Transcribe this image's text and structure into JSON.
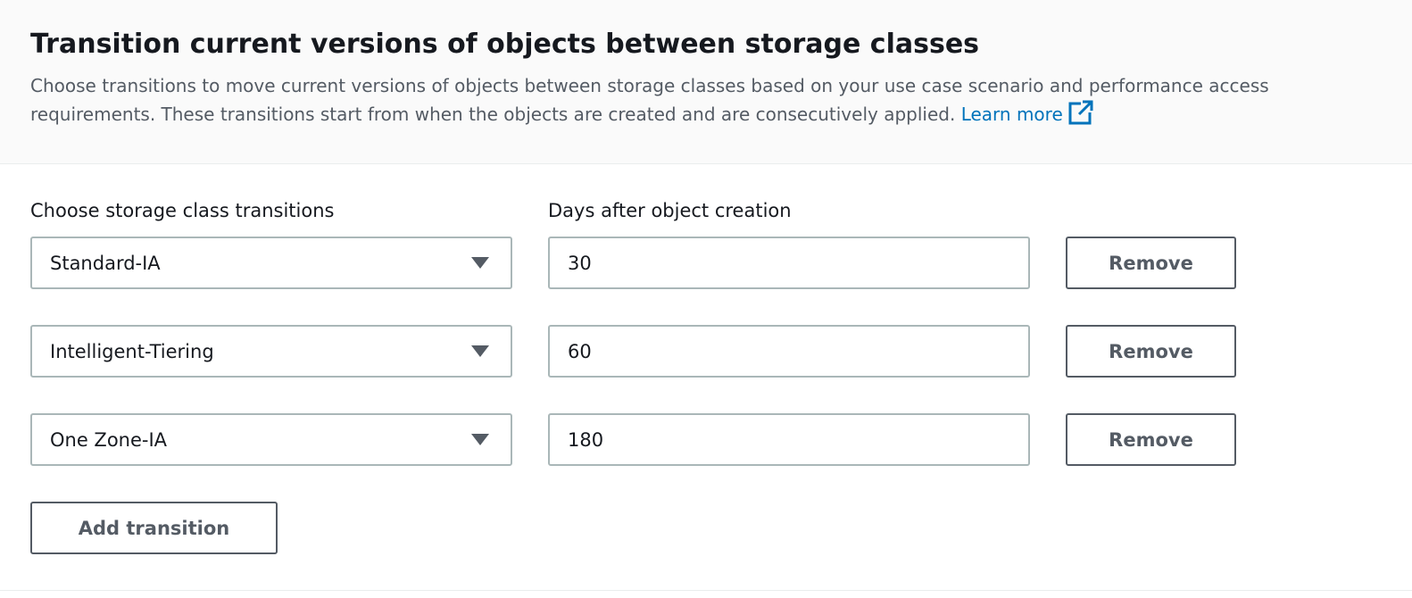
{
  "header": {
    "title": "Transition current versions of objects between storage classes",
    "description": "Choose transitions to move current versions of objects between storage classes based on your use case scenario and performance access requirements. These transitions start from when the objects are created and are consecutively applied.",
    "learn_more": "Learn more",
    "learn_more_icon": "external-link-icon",
    "link_color": "#0073bb"
  },
  "form": {
    "storage_class_label": "Choose storage class transitions",
    "days_label": "Days after object creation",
    "transitions": [
      {
        "storage_class": "Standard-IA",
        "days": "30",
        "remove_label": "Remove"
      },
      {
        "storage_class": "Intelligent-Tiering",
        "days": "60",
        "remove_label": "Remove"
      },
      {
        "storage_class": "One Zone-IA",
        "days": "180",
        "remove_label": "Remove"
      }
    ],
    "add_label": "Add transition"
  }
}
